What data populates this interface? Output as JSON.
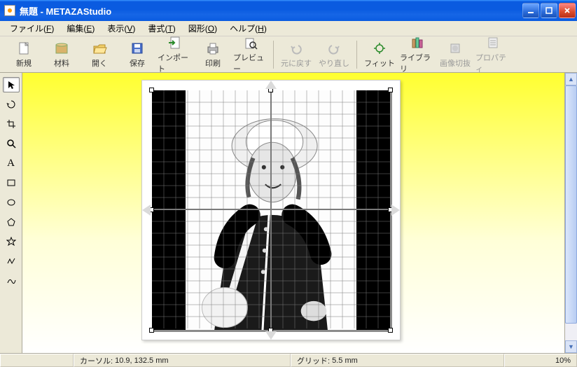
{
  "window": {
    "title": "無題 - METAZAStudio"
  },
  "menus": [
    {
      "label": "ファイル",
      "accel": "F"
    },
    {
      "label": "編集",
      "accel": "E"
    },
    {
      "label": "表示",
      "accel": "V"
    },
    {
      "label": "書式",
      "accel": "T"
    },
    {
      "label": "図形",
      "accel": "O"
    },
    {
      "label": "ヘルプ",
      "accel": "H"
    }
  ],
  "toolbar": {
    "items": [
      {
        "id": "new",
        "label": "新規",
        "icon": "new-doc",
        "enabled": true
      },
      {
        "id": "material",
        "label": "材料",
        "icon": "material",
        "enabled": true
      },
      {
        "id": "open",
        "label": "開く",
        "icon": "folder-open",
        "enabled": true
      },
      {
        "id": "save",
        "label": "保存",
        "icon": "floppy",
        "enabled": true
      },
      {
        "id": "import",
        "label": "インポート",
        "icon": "import",
        "enabled": true
      },
      {
        "id": "print",
        "label": "印刷",
        "icon": "printer",
        "enabled": true
      },
      {
        "id": "preview",
        "label": "プレビュー",
        "icon": "preview",
        "enabled": true
      },
      {
        "id": "undo",
        "label": "元に戻す",
        "icon": "undo",
        "enabled": false
      },
      {
        "id": "redo",
        "label": "やり直し",
        "icon": "redo",
        "enabled": false
      },
      {
        "id": "fit",
        "label": "フィット",
        "icon": "fit",
        "enabled": true
      },
      {
        "id": "library",
        "label": "ライブラリ",
        "icon": "library",
        "enabled": true
      },
      {
        "id": "imgclip",
        "label": "画像切抜",
        "icon": "crop",
        "enabled": false
      },
      {
        "id": "property",
        "label": "プロパティ",
        "icon": "properties",
        "enabled": false
      }
    ]
  },
  "tools": [
    {
      "id": "pointer",
      "icon": "cursor",
      "active": true
    },
    {
      "id": "rotate",
      "icon": "rotate",
      "active": false
    },
    {
      "id": "crop",
      "icon": "crop-tool",
      "active": false
    },
    {
      "id": "zoom",
      "icon": "magnifier",
      "active": false
    },
    {
      "id": "text",
      "icon": "text",
      "active": false
    },
    {
      "id": "rect",
      "icon": "rect",
      "active": false
    },
    {
      "id": "ellipse",
      "icon": "ellipse",
      "active": false
    },
    {
      "id": "polygon",
      "icon": "pentagon",
      "active": false
    },
    {
      "id": "star",
      "icon": "star",
      "active": false
    },
    {
      "id": "polyline",
      "icon": "polyline",
      "active": false
    },
    {
      "id": "curve",
      "icon": "curve",
      "active": false
    }
  ],
  "status": {
    "cursor_label": "カーソル:",
    "cursor_value": "10.9, 132.5 mm",
    "grid_label": "グリッド:",
    "grid_value": "5.5 mm",
    "zoom": "10%"
  },
  "canvas": {
    "image_description": "grayscale photo of a smiling child wearing a white sun hat, dark jacket with white shoulder strap and bag, on white background; black bars left and right; grid overlay",
    "grid_divisions": 20,
    "selection_handles": 8
  },
  "colors": {
    "xp_blue": "#0a5be0",
    "xp_beige": "#ece9d8",
    "canvas_yellow": "#ffff30"
  }
}
